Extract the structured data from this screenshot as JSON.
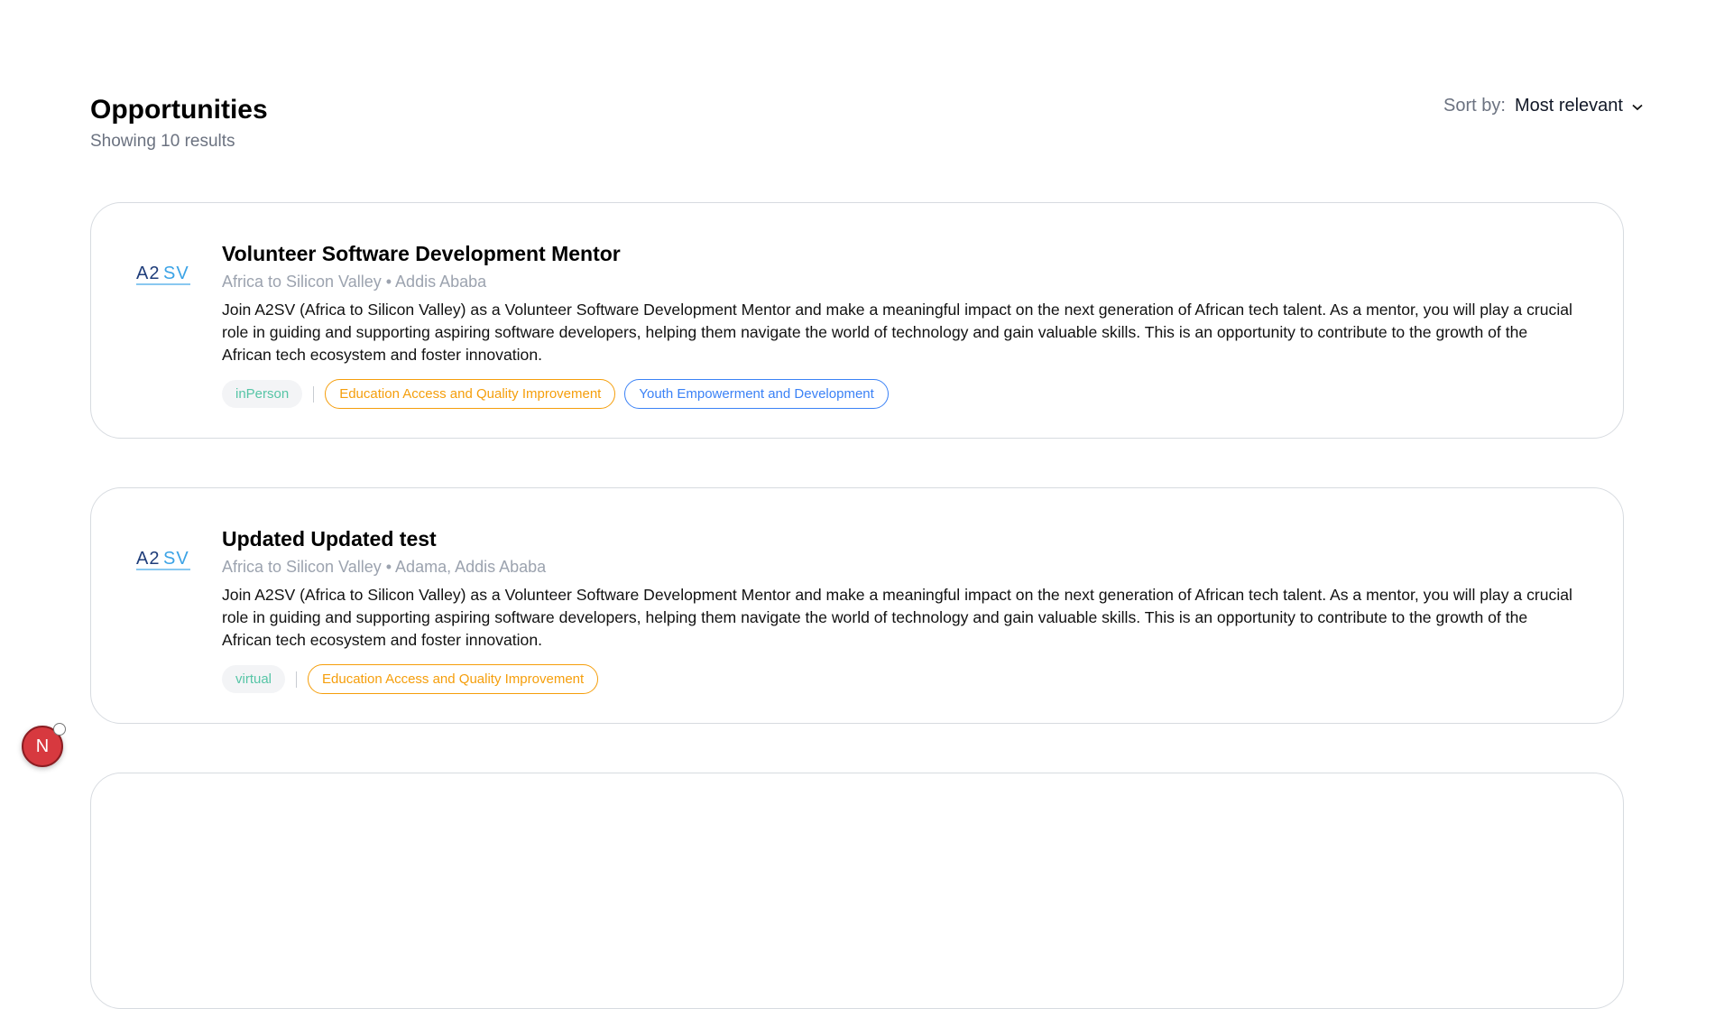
{
  "page": {
    "title": "Opportunities",
    "result_count": "Showing 10 results"
  },
  "sort": {
    "label": "Sort by:",
    "value": "Most relevant",
    "icon": "chevron-down-icon"
  },
  "opportunities": [
    {
      "logo": "A2SV",
      "title": "Volunteer Software Development Mentor",
      "meta": "Africa to Silicon Valley • Addis Ababa",
      "description": "Join A2SV (Africa to Silicon Valley) as a Volunteer Software Development Mentor and make a meaningful impact on the next generation of African tech talent. As a mentor, you will play a crucial role in guiding and supporting aspiring software developers, helping them navigate the world of technology and gain valuable skills. This is an opportunity to contribute to the growth of the African tech ecosystem and foster innovation.",
      "mode": "inPerson",
      "tags": [
        "Education Access and Quality Improvement",
        "Youth Empowerment and Development"
      ]
    },
    {
      "logo": "A2SV",
      "title": "Updated Updated test",
      "meta": "Africa to Silicon Valley • Adama, Addis Ababa",
      "description": "Join A2SV (Africa to Silicon Valley) as a Volunteer Software Development Mentor and make a meaningful impact on the next generation of African tech talent. As a mentor, you will play a crucial role in guiding and supporting aspiring software developers, helping them navigate the world of technology and gain valuable skills. This is an opportunity to contribute to the growth of the African tech ecosystem and foster innovation.",
      "mode": "virtual",
      "tags": [
        "Education Access and Quality Improvement"
      ]
    }
  ],
  "fab": {
    "label": "N"
  },
  "colors": {
    "mode_text": "#56c5a6",
    "tag_orange": "#f59e0b",
    "tag_blue": "#3b82f6",
    "fab_bg": "#d7393f",
    "logo_dark": "#1f3d7a",
    "logo_light": "#3ba3e6"
  }
}
